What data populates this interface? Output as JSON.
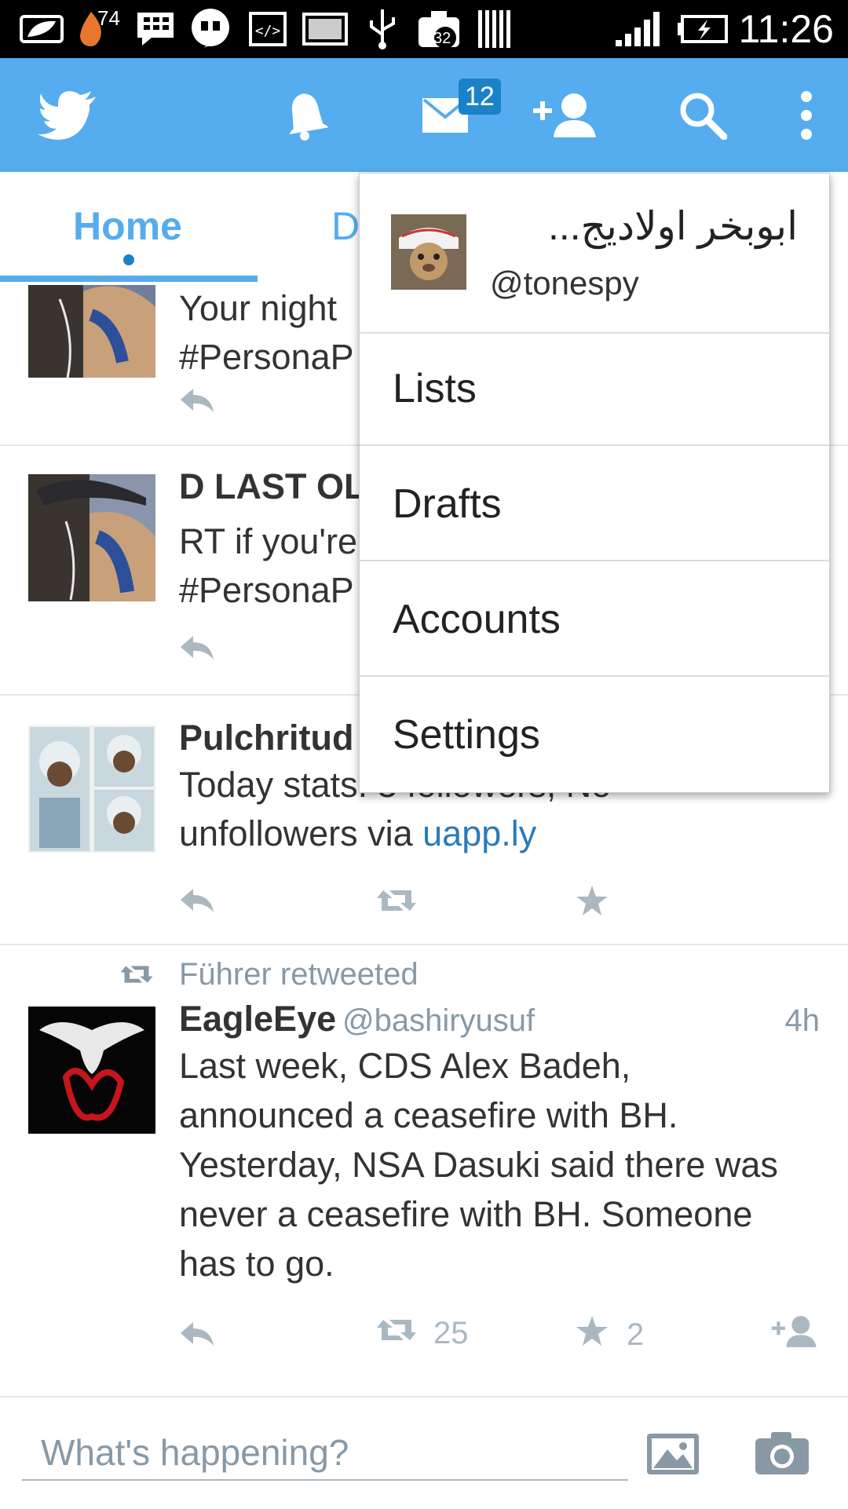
{
  "status_bar": {
    "notification_count": "74",
    "camera_count": "32",
    "time": "11:26",
    "icons": [
      "leaf-icon",
      "flame-icon",
      "bbm-icon",
      "hangouts-icon",
      "code-icon",
      "image-icon",
      "usb-icon",
      "camera-badge-icon",
      "barcode-icon",
      "signal-icon",
      "battery-icon"
    ]
  },
  "app_bar": {
    "color": "#55acee",
    "messages_badge": "12",
    "icons": [
      "twitter-bird-icon",
      "notifications-bell-icon",
      "messages-envelope-icon",
      "add-user-icon",
      "search-icon",
      "overflow-menu-icon"
    ]
  },
  "tabs": {
    "home_label": "Home",
    "second_label_partial": "D"
  },
  "tweets": [
    {
      "text_line1": "Your night",
      "text_line2": "#PersonaP"
    },
    {
      "name": "D LAST OL",
      "text_line1": "RT if you're",
      "text_line2": "#PersonaP"
    },
    {
      "name": "Pulchritud",
      "text_line1": "Today stats: 3 followers, No",
      "text_line2_prefix": "unfollowers via ",
      "link": "uapp.ly"
    },
    {
      "retweeted_by": "Führer retweeted",
      "name": "EagleEye",
      "handle": "@bashiryusuf",
      "time": "4h",
      "lines": [
        "Last week, CDS Alex Badeh,",
        "announced a ceasefire with BH.",
        "Yesterday, NSA Dasuki said there was",
        "never a ceasefire with BH. Someone",
        "has to go."
      ],
      "retweets": "25",
      "favorites": "2"
    }
  ],
  "composer": {
    "placeholder": "What's happening?"
  },
  "menu": {
    "display_name": "ابوبخر اولاديج...",
    "handle": "@tonespy",
    "items": [
      "Lists",
      "Drafts",
      "Accounts",
      "Settings"
    ]
  }
}
